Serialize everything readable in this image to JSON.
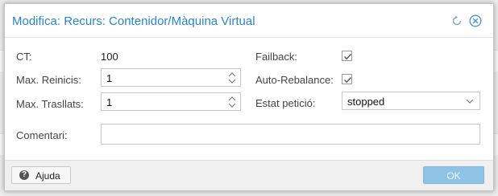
{
  "dialog": {
    "title": "Modifica: Recurs: Contenidor/Màquina Virtual",
    "refresh_icon": "refresh-icon",
    "close_icon": "close-icon"
  },
  "form": {
    "ct": {
      "label": "CT:",
      "value": "100"
    },
    "max_restarts": {
      "label": "Max. Reinicis:",
      "value": "1"
    },
    "max_relocates": {
      "label": "Max. Trasllats:",
      "value": "1"
    },
    "failback": {
      "label": "Failback:",
      "checked": true
    },
    "auto_rebalance": {
      "label": "Auto-Rebalance:",
      "checked": true
    },
    "state": {
      "label": "Estat petició:",
      "value": "stopped"
    },
    "comment": {
      "label": "Comentari:",
      "value": ""
    }
  },
  "footer": {
    "help_label": "Ajuda",
    "ok_label": "OK"
  },
  "colors": {
    "title": "#2d83c5",
    "ok_disabled": "#8fc3e6"
  }
}
